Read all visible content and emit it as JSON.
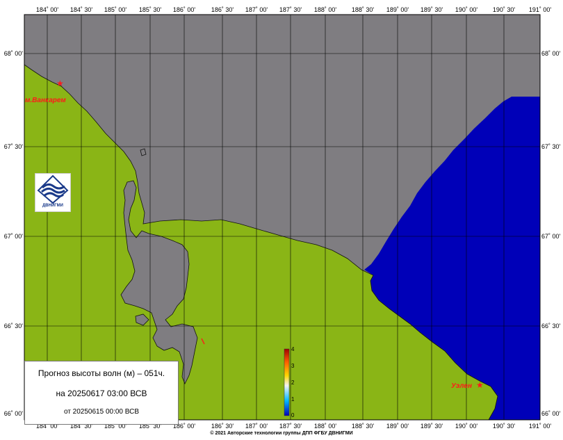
{
  "map": {
    "lon_ticks": [
      "184˚ 00'",
      "184˚ 30'",
      "185˚ 00'",
      "185˚ 30'",
      "186˚ 00'",
      "186˚ 30'",
      "187˚ 00'",
      "187˚ 30'",
      "188˚ 00'",
      "188˚ 30'",
      "189˚ 00'",
      "189˚ 30'",
      "190˚ 00'",
      "190˚ 30'",
      "191˚ 00'"
    ],
    "lat_ticks": [
      "68˚ 00'",
      "67˚ 30'",
      "67˚ 00'",
      "66˚ 30'",
      "66˚ 00'"
    ],
    "places": {
      "vankarem": "м.Ванкарем",
      "uelen": "Уэлен"
    },
    "colors": {
      "land": "#8ab516",
      "sea_no_data": "#7f7d81",
      "sea_wave_low": "#0000b8",
      "grid": "#000000",
      "marker": "#ff1a1a"
    }
  },
  "colorbar": {
    "labels": [
      "4",
      "3",
      "2",
      "1",
      "0"
    ],
    "range": [
      0,
      4
    ]
  },
  "forecast": {
    "title": "Прогноз высоты волн (м) – 051ч.",
    "valid": "на 20250617 03:00 ВСВ",
    "issued": "от 20250615 00:00 ВСВ"
  },
  "logo": {
    "text": "ДВНИГМИ"
  },
  "footer": "© 2021 Авторские технологии группы ДПП ФГБУ ДВНИГМИ"
}
